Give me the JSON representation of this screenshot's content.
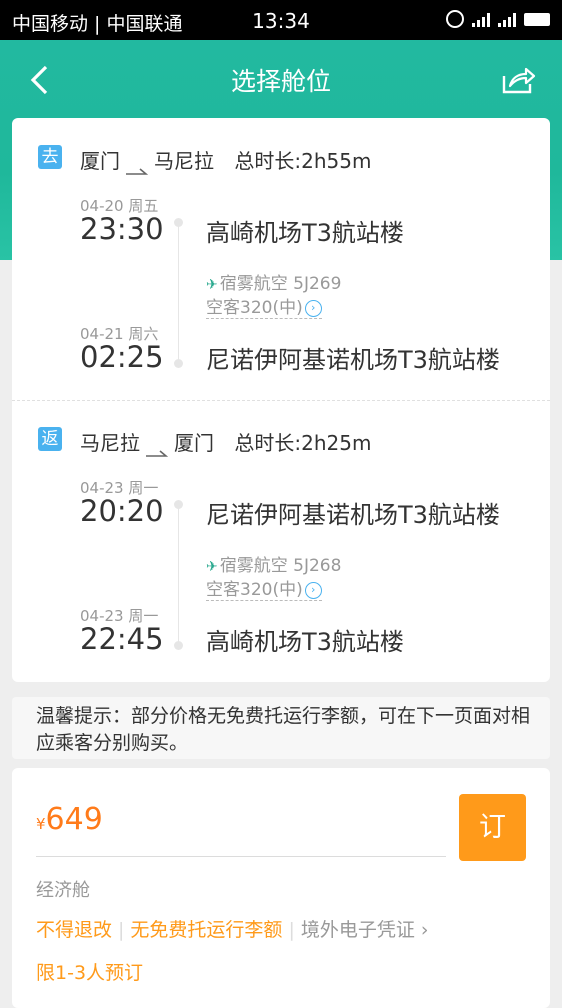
{
  "status_bar": {
    "carrier": "中国移动 | 中国联通",
    "time": "13:34",
    "network": "4G"
  },
  "header": {
    "title": "选择舱位",
    "back_icon": "chevron-left-icon",
    "share_icon": "share-icon"
  },
  "outbound": {
    "tag": "去",
    "from_city": "厦门",
    "to_city": "马尼拉",
    "duration": "总时长:2h55m",
    "dep_date": "04-20 周五",
    "dep_time": "23:30",
    "dep_airport": "高崎机场T3航站楼",
    "airline": "宿雾航空 5J269",
    "aircraft": "空客320(中)",
    "arr_date": "04-21 周六",
    "arr_time": "02:25",
    "arr_airport": "尼诺伊阿基诺机场T3航站楼"
  },
  "return": {
    "tag": "返",
    "from_city": "马尼拉",
    "to_city": "厦门",
    "duration": "总时长:2h25m",
    "dep_date": "04-23 周一",
    "dep_time": "20:20",
    "dep_airport": "尼诺伊阿基诺机场T3航站楼",
    "airline": "宿雾航空 5J268",
    "aircraft": "空客320(中)",
    "arr_date": "04-23 周一",
    "arr_time": "22:45",
    "arr_airport": "高崎机场T3航站楼"
  },
  "notice": "温馨提示：部分价格无免费托运行李额，可在下一页面对相应乘客分别购买。",
  "fare": {
    "currency": "¥",
    "price": "649",
    "book_label": "订",
    "cabin": "经济舱",
    "tags": [
      "不得退改",
      "无免费托运行李额"
    ],
    "voucher": "境外电子凭证",
    "limit": "限1-3人预订"
  },
  "colors": {
    "header": "#1fb89b",
    "accent_orange": "#ff9a1a",
    "tag_blue": "#4ab2ef"
  }
}
